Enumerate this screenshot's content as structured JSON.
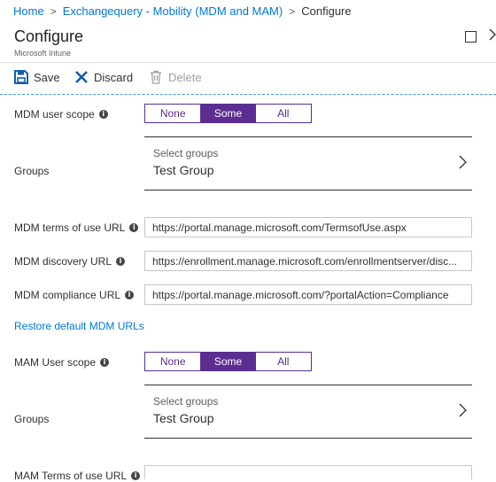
{
  "breadcrumb": {
    "items": [
      "Home",
      "Exchangequery - Mobility (MDM and MAM)",
      "Configure"
    ],
    "separator": ">"
  },
  "header": {
    "title": "Configure",
    "subtitle": "Microsoft Intune",
    "icons": [
      "maximize-icon",
      "close-icon"
    ]
  },
  "toolbar": {
    "save_label": "Save",
    "discard_label": "Discard",
    "delete_label": "Delete",
    "save_icon": "save-icon",
    "discard_icon": "discard-icon",
    "delete_icon": "trash-icon"
  },
  "mdm": {
    "user_scope_label": "MDM user scope",
    "scope_options": [
      "None",
      "Some",
      "All"
    ],
    "scope_selected": "Some",
    "groups_label": "Groups",
    "groups_picker_title": "Select groups",
    "groups_picker_value": "Test Group",
    "terms_label": "MDM terms of use URL",
    "terms_value": "https://portal.manage.microsoft.com/TermsofUse.aspx",
    "discovery_label": "MDM discovery URL",
    "discovery_value": "https://enrollment.manage.microsoft.com/enrollmentserver/disc...",
    "compliance_label": "MDM compliance URL",
    "compliance_value": "https://portal.manage.microsoft.com/?portalAction=Compliance",
    "restore_link": "Restore default MDM URLs"
  },
  "mam": {
    "user_scope_label": "MAM User scope",
    "scope_options": [
      "None",
      "Some",
      "All"
    ],
    "scope_selected": "Some",
    "groups_label": "Groups",
    "groups_picker_title": "Select groups",
    "groups_picker_value": "Test Group",
    "terms_label": "MAM Terms of use URL",
    "terms_value": ""
  },
  "colors": {
    "accent": "#5c2d91",
    "link": "#0078d4",
    "text": "#323130"
  }
}
